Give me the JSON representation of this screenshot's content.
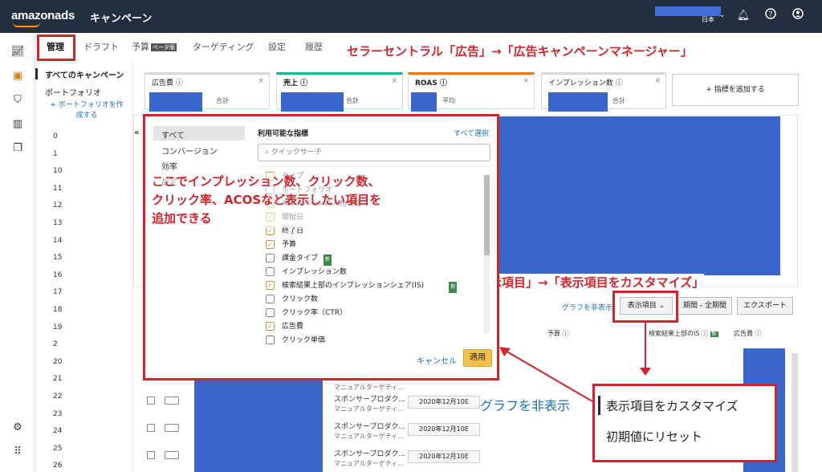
{
  "topbar": {
    "logo": "amazonads",
    "title": "キャンペーン",
    "locale": "日本"
  },
  "tabs": [
    {
      "label": "管理"
    },
    {
      "label": "ドラフト"
    },
    {
      "label": "予算",
      "badge": "ベータ版"
    },
    {
      "label": "ターゲティング"
    },
    {
      "label": "設定"
    },
    {
      "label": "履歴"
    }
  ],
  "annotations": {
    "top": "セラーセントラル「広告」→「広告キャンペーンマネージャー」",
    "middle": "示項目」→「表示項目をカスタマイズ」",
    "popup_line1": "ここでインプレッション数、クリック数、",
    "popup_line2": "クリック率、ACOSなど表示したい項目を",
    "popup_line3": "追加できる"
  },
  "sidebar": {
    "all_campaigns": "すべてのキャンペーン",
    "portfolio": "ポートフォリオ",
    "create_portfolio": "+ ポートフォリオを作成する",
    "row_numbers": [
      "0",
      "1",
      "10",
      "11",
      "12",
      "13",
      "14",
      "15",
      "16",
      "17",
      "18",
      "19",
      "2",
      "20",
      "21",
      "22",
      "23",
      "24",
      "25",
      "26"
    ]
  },
  "cards": [
    {
      "label": "広告費",
      "sub": "合計"
    },
    {
      "label": "売上",
      "sub": "合計"
    },
    {
      "label": "ROAS",
      "sub": "平均"
    },
    {
      "label": "インプレッション数",
      "sub": "合計"
    }
  ],
  "add_metric": "+ 指標を追加する",
  "toolbar": {
    "hide_graph": "グラフを非表示",
    "display_items": "表示項目",
    "period": "期間 - 全期間",
    "export": "エクスポート"
  },
  "table_headers": {
    "budget": "予算",
    "impression_share": "検索結果上部のIS",
    "ad_spend": "広告費"
  },
  "rows": [
    {
      "name": "スポンサープロダク...",
      "sub": "マニュアルターゲティ...",
      "date": "2020年12月10E"
    },
    {
      "name": "スポンサープロダク...",
      "sub": "マニュアルターゲティ...",
      "date": "2020年12月10E"
    },
    {
      "name": "スポンサープロダク...",
      "sub": "マニュアルターゲティ...",
      "date": "2020年12月10E"
    }
  ],
  "partial_row_sub": "マニュアルターゲティ...",
  "popup": {
    "categories": [
      "すべて",
      "コンバージョン",
      "効率",
      "設定"
    ],
    "title": "利用可能な指標",
    "select_all": "すべて選択",
    "search_placeholder": "クイックサーチ",
    "metrics": [
      {
        "label": "タイプ",
        "checked": true
      },
      {
        "label": "ポートフォリオ",
        "checked": false
      },
      {
        "label": "キャンペーンの入札戦略",
        "checked": true
      },
      {
        "label": "開始日",
        "checked": true
      },
      {
        "label": "終了日",
        "checked": true
      },
      {
        "label": "予算",
        "checked": true
      },
      {
        "label": "課金タイプ",
        "checked": false,
        "badge": "新"
      },
      {
        "label": "インプレッション数",
        "checked": false
      },
      {
        "label": "検索結果上部のインプレッションシェア(IS)",
        "checked": true,
        "badge": "新"
      },
      {
        "label": "クリック数",
        "checked": false
      },
      {
        "label": "クリック率（CTR）",
        "checked": false
      },
      {
        "label": "広告費",
        "checked": true
      },
      {
        "label": "クリック単価",
        "checked": false
      }
    ],
    "cancel": "キャンセル",
    "apply": "適用"
  },
  "dropdown": {
    "customize": "表示項目をカスタマイズ",
    "reset": "初期値にリセット"
  },
  "big_hide_graph": "グラフを非表示"
}
